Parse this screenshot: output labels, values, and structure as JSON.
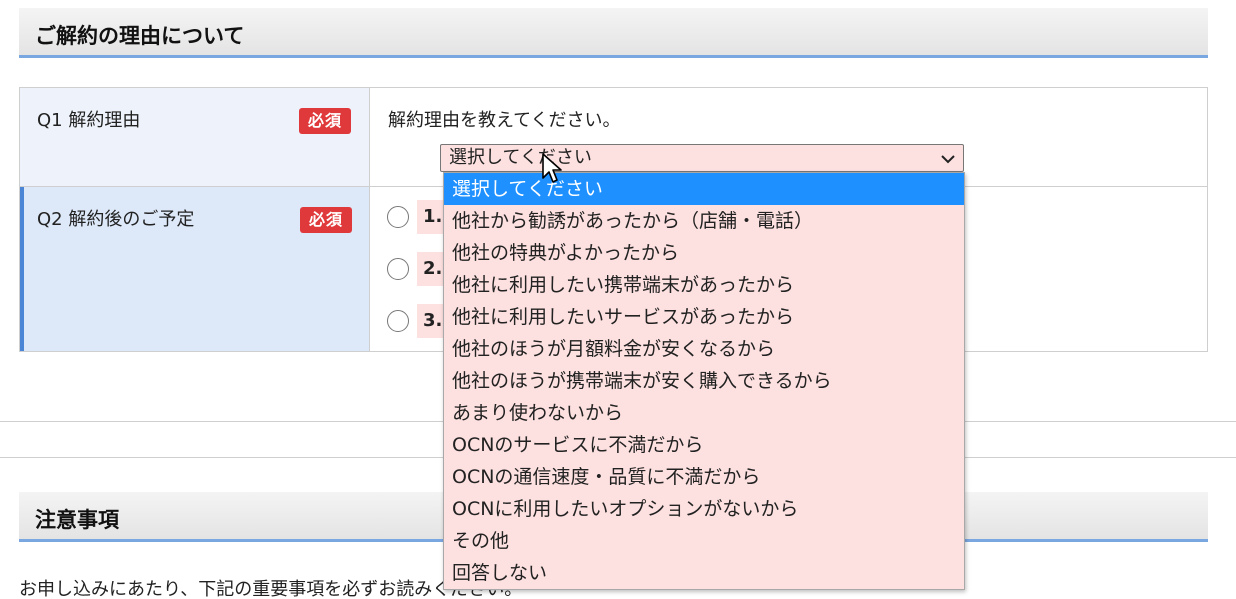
{
  "sections": {
    "reason_title": "ご解約の理由について",
    "notes_title": "注意事項"
  },
  "q1": {
    "label": "Q1 解約理由",
    "required_badge": "必須",
    "prompt": "解約理由を教えてください。",
    "select_value": "選択してください"
  },
  "q2": {
    "label": "Q2 解約後のご予定",
    "required_badge": "必須",
    "options": [
      "1.",
      "2.",
      "3."
    ]
  },
  "dropdown": {
    "selected_index": 0,
    "options": [
      "選択してください",
      "他社から勧誘があったから（店舗・電話）",
      "他社の特典がよかったから",
      "他社に利用したい携帯端末があったから",
      "他社に利用したいサービスがあったから",
      "他社のほうが月額料金が安くなるから",
      "他社のほうが携帯端末が安く購入できるから",
      "あまり使わないから",
      "OCNのサービスに不満だから",
      "OCNの通信速度・品質に不満だから",
      "OCNに利用したいオプションがないから",
      "その他",
      "回答しない"
    ]
  },
  "notice_text": "お申し込みにあたり、下記の重要事項を必ずお読みください。",
  "colors": {
    "required_badge": "#e0393b",
    "highlight": "#1e90ff",
    "field_bg": "#fde0e0",
    "accent_bar": "#4b86d6"
  },
  "icons": {
    "select_chevron": "chevron-down-icon",
    "pointer": "mouse-cursor-icon"
  }
}
